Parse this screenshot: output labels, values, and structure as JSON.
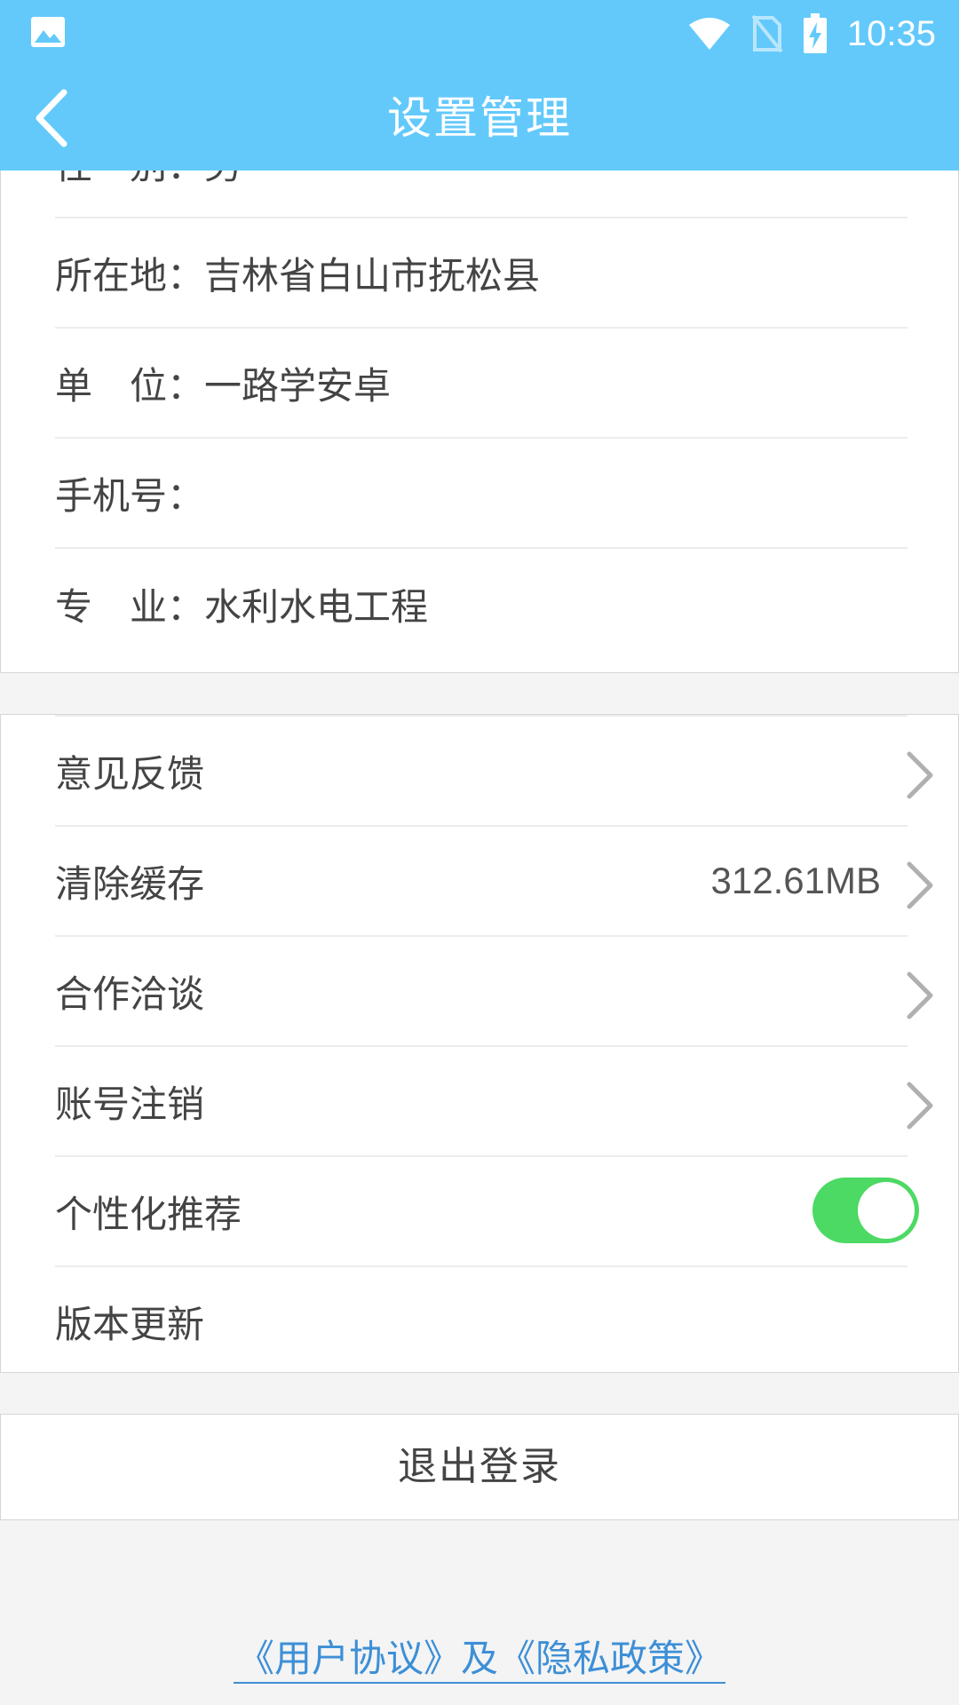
{
  "status_bar": {
    "time": "10:35",
    "left_icon": "image-icon",
    "right_icons": [
      "wifi-icon",
      "no-sim-icon",
      "battery-charging-icon"
    ],
    "color": "#63c9fb"
  },
  "app_bar": {
    "title": "设置管理",
    "back_icon": "back-arrow-icon"
  },
  "profile": {
    "items": [
      {
        "label": "性　别：",
        "value": "男"
      },
      {
        "label": "所在地：",
        "value": "吉林省白山市抚松县"
      },
      {
        "label": "单　位：",
        "value": "一路学安卓"
      },
      {
        "label": "手机号：",
        "value": ""
      },
      {
        "label": "专　业：",
        "value": "水利水电工程"
      }
    ]
  },
  "settings": {
    "items": [
      {
        "label": "意见反馈",
        "value": "",
        "accessory": "chevron-right-icon"
      },
      {
        "label": "清除缓存",
        "value": "312.61MB",
        "accessory": "chevron-right-icon"
      },
      {
        "label": "合作洽谈",
        "value": "",
        "accessory": "chevron-right-icon"
      },
      {
        "label": "账号注销",
        "value": "",
        "accessory": "chevron-right-icon"
      },
      {
        "label": "个性化推荐",
        "value": "",
        "accessory": "toggle",
        "toggle_on": true
      },
      {
        "label": "版本更新",
        "value": "",
        "accessory": ""
      }
    ],
    "toggle_color": "#4cd964"
  },
  "logout": {
    "label": "退出登录"
  },
  "policy": {
    "text": "《用户协议》及《隐私政策》",
    "color": "#3d8fd6"
  }
}
